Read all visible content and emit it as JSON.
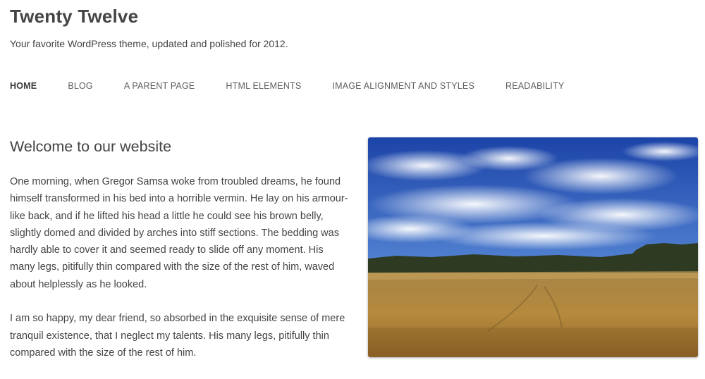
{
  "site": {
    "title": "Twenty Twelve",
    "description": "Your favorite WordPress theme, updated and polished for 2012."
  },
  "nav": {
    "items": [
      {
        "label": "HOME",
        "current": true
      },
      {
        "label": "BLOG"
      },
      {
        "label": "A PARENT PAGE"
      },
      {
        "label": "HTML ELEMENTS"
      },
      {
        "label": "IMAGE ALIGNMENT AND STYLES"
      },
      {
        "label": "READABILITY"
      }
    ]
  },
  "page": {
    "title": "Welcome to our website",
    "paragraphs": [
      "One morning, when Gregor Samsa woke from troubled dreams, he found himself transformed in his bed into a horrible vermin. He lay on his armour-like back, and if he lifted his head a little he could see his brown belly, slightly domed and divided by arches into stiff sections. The bedding was hardly able to cover it and seemed ready to slide off any moment. His many legs, pitifully thin compared with the size of the rest of him, waved about helplessly as he looked.",
      "I am so happy, my dear friend, so absorbed in the exquisite sense of mere tranquil existence, that I neglect my talents. His many legs, piti­fully thin compared with the size of the rest of him."
    ]
  },
  "colors": {
    "text": "#444444",
    "nav_text": "#5e5e5e",
    "sky_top": "#1f4ab0",
    "sky_bottom": "#6f9ad8",
    "field": "#b58a3c"
  }
}
